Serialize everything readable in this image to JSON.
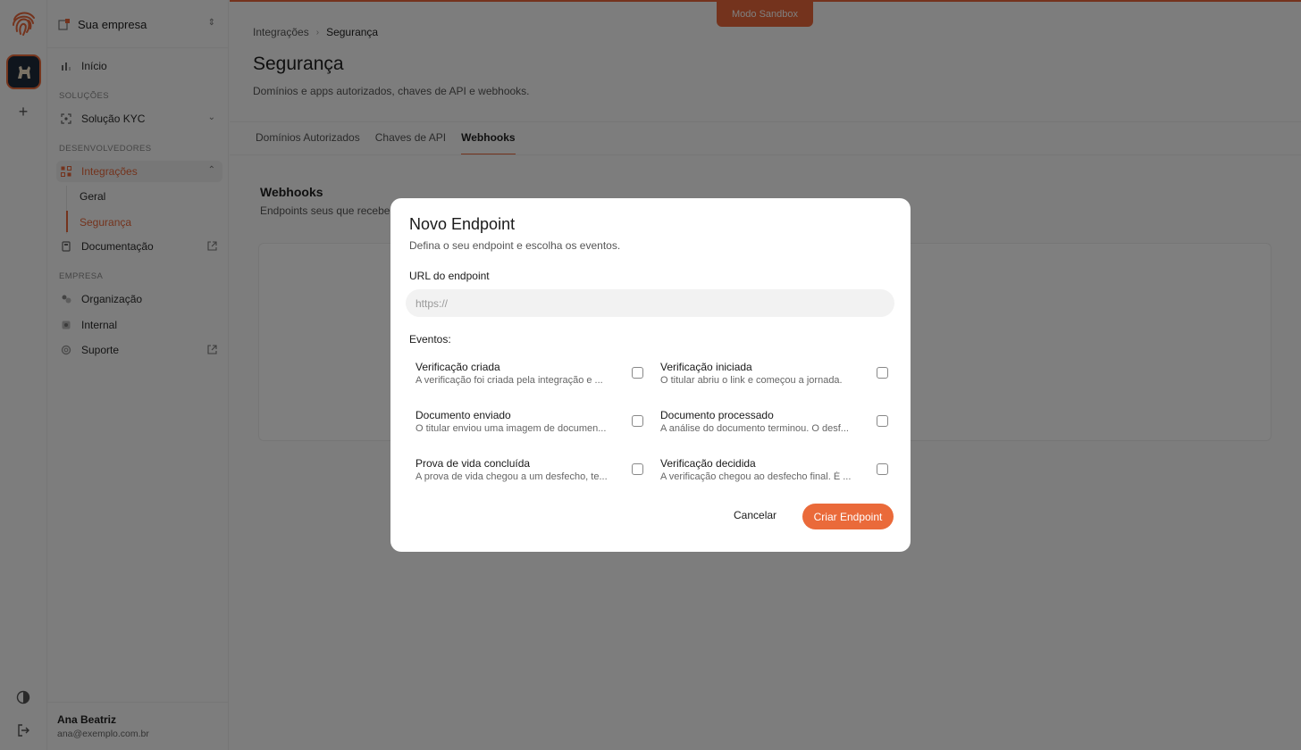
{
  "rail": {
    "icons": [
      "fingerprint-logo-icon",
      "app-avatar-icon",
      "plus-icon",
      "theme-toggle-icon",
      "logout-icon"
    ],
    "add_label": "+"
  },
  "sidebar": {
    "company": "Sua empresa",
    "nav": {
      "home": "Início",
      "section_solutions": "SOLUÇÕES",
      "kyc": "Solução KYC",
      "section_devs": "DESENVOLVEDORES",
      "integrations": "Integrações",
      "general": "Geral",
      "security": "Segurança",
      "docs": "Documentação",
      "section_company": "EMPRESA",
      "organization": "Organização",
      "internal": "Internal",
      "support": "Suporte"
    },
    "user": {
      "name": "Ana Beatriz",
      "email": "ana@exemplo.com.br"
    }
  },
  "header": {
    "sandbox": "Modo Sandbox",
    "breadcrumb": [
      "Integrações",
      "Segurança"
    ],
    "title": "Segurança",
    "subtitle": "Domínios e apps autorizados, chaves de API e webhooks."
  },
  "tabs": [
    "Domínios Autorizados",
    "Chaves de API",
    "Webhooks"
  ],
  "webhooks": {
    "title": "Webhooks",
    "subtitle": "Endpoints seus que recebe"
  },
  "modal": {
    "title": "Novo Endpoint",
    "subtitle": "Defina o seu endpoint e escolha os eventos.",
    "url_label": "URL do endpoint",
    "url_placeholder": "https://",
    "url_value": "",
    "events_label": "Eventos:",
    "events": [
      {
        "title": "Verificação criada",
        "desc": "A verificação foi criada pela integração e ...",
        "checked": false
      },
      {
        "title": "Verificação iniciada",
        "desc": "O titular abriu o link e começou a jornada.",
        "checked": false
      },
      {
        "title": "Documento enviado",
        "desc": "O titular enviou uma imagem de documen...",
        "checked": false
      },
      {
        "title": "Documento processado",
        "desc": "A análise do documento terminou. O desf...",
        "checked": false
      },
      {
        "title": "Prova de vida concluída",
        "desc": "A prova de vida chegou a um desfecho, te...",
        "checked": false
      },
      {
        "title": "Verificação decidida",
        "desc": "A verificação chegou ao desfecho final. É ...",
        "checked": false
      }
    ],
    "cancel": "Cancelar",
    "create": "Criar Endpoint"
  },
  "colors": {
    "accent": "#e8673a",
    "overlay": "rgba(0,0,0,0.5)"
  }
}
